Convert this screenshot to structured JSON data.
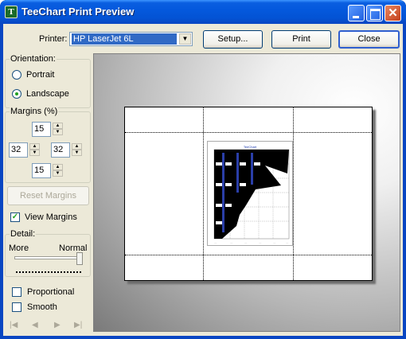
{
  "window": {
    "title": "TeeChart Print Preview"
  },
  "toolbar": {
    "printer_label": "Printer:",
    "printer_value": "HP LaserJet 6L",
    "setup_label": "Setup...",
    "print_label": "Print",
    "close_label": "Close"
  },
  "orientation": {
    "label": "Orientation:",
    "portrait": "Portrait",
    "landscape": "Landscape",
    "selected": "Landscape"
  },
  "margins": {
    "label": "Margins (%)",
    "top": "15",
    "left": "32",
    "right": "32",
    "bottom": "15",
    "reset_label": "Reset Margins"
  },
  "view_margins": {
    "label": "View Margins",
    "checked": true
  },
  "detail": {
    "label": "Detail:",
    "more": "More",
    "normal": "Normal",
    "level": 1.0
  },
  "options": {
    "proportional": "Proportional",
    "smooth": "Smooth"
  },
  "chart_preview": {
    "title": "TeeChart"
  }
}
